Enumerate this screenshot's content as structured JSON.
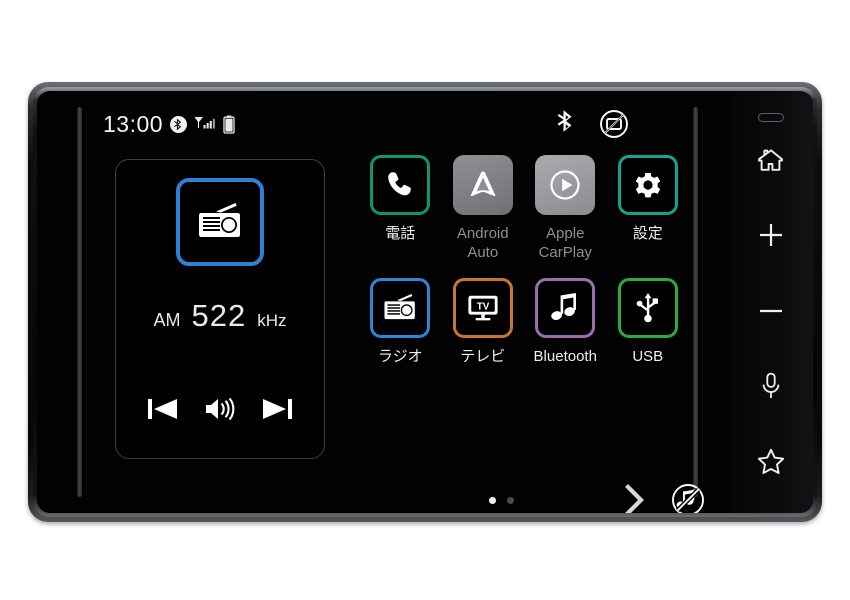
{
  "device": {
    "type": "car-infotainment-head-unit",
    "status_bar": {
      "clock": "13:00",
      "left_icons": [
        "bluetooth-icon",
        "signal-icon",
        "battery-icon"
      ],
      "right_icons": [
        "bluetooth-icon",
        "display-off-icon"
      ]
    }
  },
  "radio_panel": {
    "source_icon": "radio-icon",
    "tile_border_color": "#2f7fd6",
    "band": "AM",
    "frequency": "522",
    "unit": "kHz",
    "controls": [
      {
        "name": "previous-track-button",
        "icon": "skip-previous-icon"
      },
      {
        "name": "volume-button",
        "icon": "speaker-volume-icon"
      },
      {
        "name": "next-track-button",
        "icon": "skip-next-icon"
      }
    ]
  },
  "apps": {
    "row1": [
      {
        "label": "電話",
        "icon": "phone-icon",
        "border_color": "#149272",
        "style": "bordered",
        "enabled": true
      },
      {
        "label": "Android\nAuto",
        "icon": "android-auto-icon",
        "tile_color": "#84868a",
        "style": "filled",
        "enabled": false
      },
      {
        "label": "Apple\nCarPlay",
        "icon": "apple-carplay-icon",
        "tile_color": "#9b9ea1",
        "style": "filled",
        "enabled": false
      },
      {
        "label": "設定",
        "icon": "gear-icon",
        "border_color": "#12a58a",
        "style": "bordered",
        "enabled": true
      }
    ],
    "row2": [
      {
        "label": "ラジオ",
        "icon": "radio-icon",
        "border_color": "#2f86d6",
        "style": "bordered",
        "enabled": true
      },
      {
        "label": "テレビ",
        "icon": "tv-icon",
        "border_color": "#c8762f",
        "style": "bordered",
        "enabled": true
      },
      {
        "label": "Bluetooth",
        "icon": "music-note-icon",
        "border_color": "#9a6fae",
        "style": "bordered",
        "enabled": true
      },
      {
        "label": "USB",
        "icon": "usb-icon",
        "border_color": "#2eaa3e",
        "style": "bordered",
        "enabled": true
      }
    ]
  },
  "bottom_bar": {
    "page_count": 2,
    "active_page": 1,
    "next_page_icon": "chevron-right-icon",
    "mute_icon": "mute-music-icon"
  },
  "hardware_keys": [
    {
      "name": "sensor",
      "icon": "ir-sensor-icon"
    },
    {
      "name": "home-key",
      "icon": "home-icon"
    },
    {
      "name": "volume-up-key",
      "icon": "plus-icon"
    },
    {
      "name": "volume-down-key",
      "icon": "minus-icon"
    },
    {
      "name": "voice-key",
      "icon": "microphone-icon"
    },
    {
      "name": "favorite-key",
      "icon": "star-icon"
    }
  ]
}
